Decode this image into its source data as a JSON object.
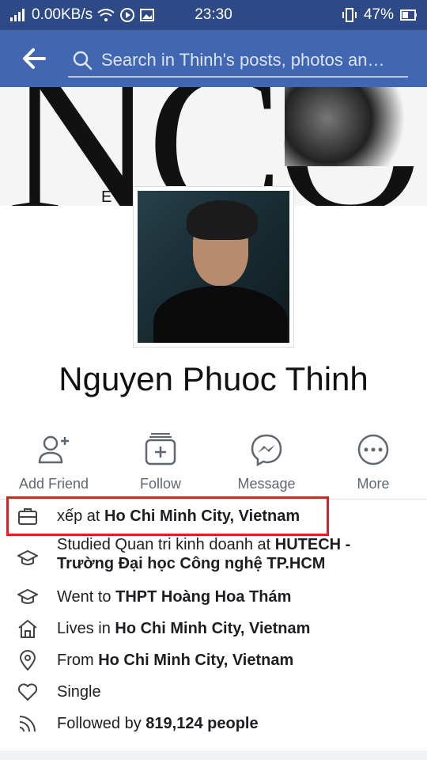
{
  "status_bar": {
    "network": "0.00KB/s",
    "time": "23:30",
    "battery": "47%"
  },
  "header": {
    "search_placeholder": "Search in Thinh's posts, photos an…"
  },
  "cover": {
    "letters": "NCO",
    "tagline": "EN                NT"
  },
  "profile": {
    "name": "Nguyen Phuoc Thinh"
  },
  "actions": [
    {
      "label": "Add Friend",
      "icon": "add-friend-icon"
    },
    {
      "label": "Follow",
      "icon": "follow-icon"
    },
    {
      "label": "Message",
      "icon": "messenger-icon"
    },
    {
      "label": "More",
      "icon": "more-icon"
    }
  ],
  "info": {
    "work_prefix": "xếp at ",
    "work_place": "Ho Chi Minh City, Vietnam",
    "study_prefix": "Studied Quan tri kinh doanh at ",
    "study_school": "HUTECH - Trường Đại học Công nghệ TP.HCM",
    "went_prefix": "Went to ",
    "went_school": "THPT Hoàng Hoa Thám",
    "lives_prefix": "Lives in ",
    "lives_place": "Ho Chi Minh City, Vietnam",
    "from_prefix": "From ",
    "from_place": "Ho Chi Minh City, Vietnam",
    "relationship": "Single",
    "followed_prefix": "Followed by ",
    "followed_count": "819,124 people"
  },
  "colors": {
    "header_blue": "#4267b2",
    "status_blue": "#2d4a86",
    "highlight_red": "#e31b23"
  }
}
